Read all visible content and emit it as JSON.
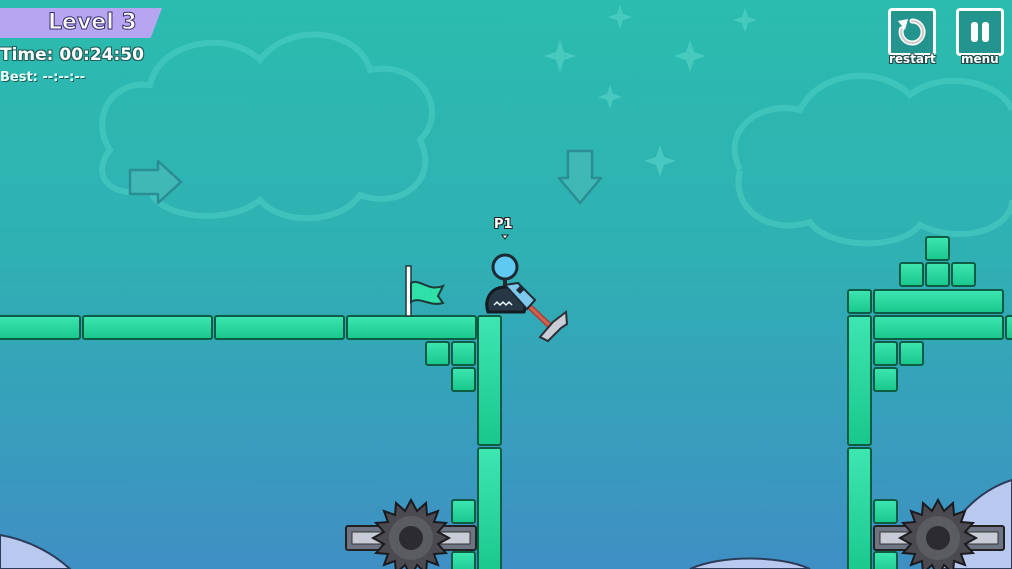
{
  "hud": {
    "level": "Level 3",
    "time": "Time: 00:24:50",
    "best": "Best: --:--:--",
    "restart_label": "restart",
    "menu_label": "menu"
  },
  "player": {
    "tag": "P1"
  },
  "icons": [
    "restart-icon",
    "pause-icon",
    "arrow-right-icon",
    "arrow-down-icon",
    "checkpoint-flag-icon",
    "spinning-saw-icon",
    "pickaxe-icon"
  ],
  "colors": {
    "block": "#20d49a",
    "block_edge": "#0f6a4e",
    "hud_level_bg": "#b6a6f2",
    "background_top": "#2bbcae",
    "background_bottom": "#3f8fc4"
  }
}
